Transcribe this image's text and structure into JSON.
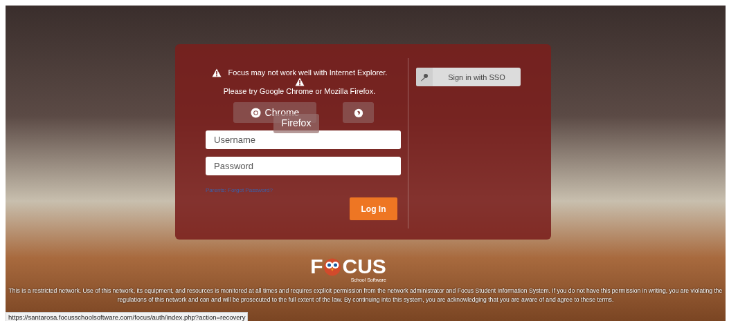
{
  "warning": {
    "line1": "Focus may not work well with Internet Explorer.",
    "line2": "Please try Google Chrome or Mozilla Firefox."
  },
  "browser_buttons": [
    {
      "kind": "chrome",
      "label": "Chrome"
    },
    {
      "kind": "firefox",
      "label": "Firefox"
    }
  ],
  "fields": [
    {
      "placeholder": "Username"
    },
    {
      "placeholder": "Password"
    }
  ],
  "forgot_link": "Parents: Forgot Password?",
  "login_button": "Log In",
  "sso_button": "Sign in with SSO",
  "logo": {
    "start": "F",
    "end": "CUS",
    "tagline": "School Software"
  },
  "notice": "This is a restricted network. Use of this network, its equipment, and resources is monitored at all times and requires explicit permission from the network administrator and Focus Student Information System. If you do not have this permission in writing, you are violating the regulations of this network and can and will be prosecuted to the full extent of the law. By continuing into this system, you are acknowledging that you are aware of and agree to these terms.",
  "status_url": "https://santarosa.focusschoolsoftware.com/focus/auth/index.php?action=recovery"
}
